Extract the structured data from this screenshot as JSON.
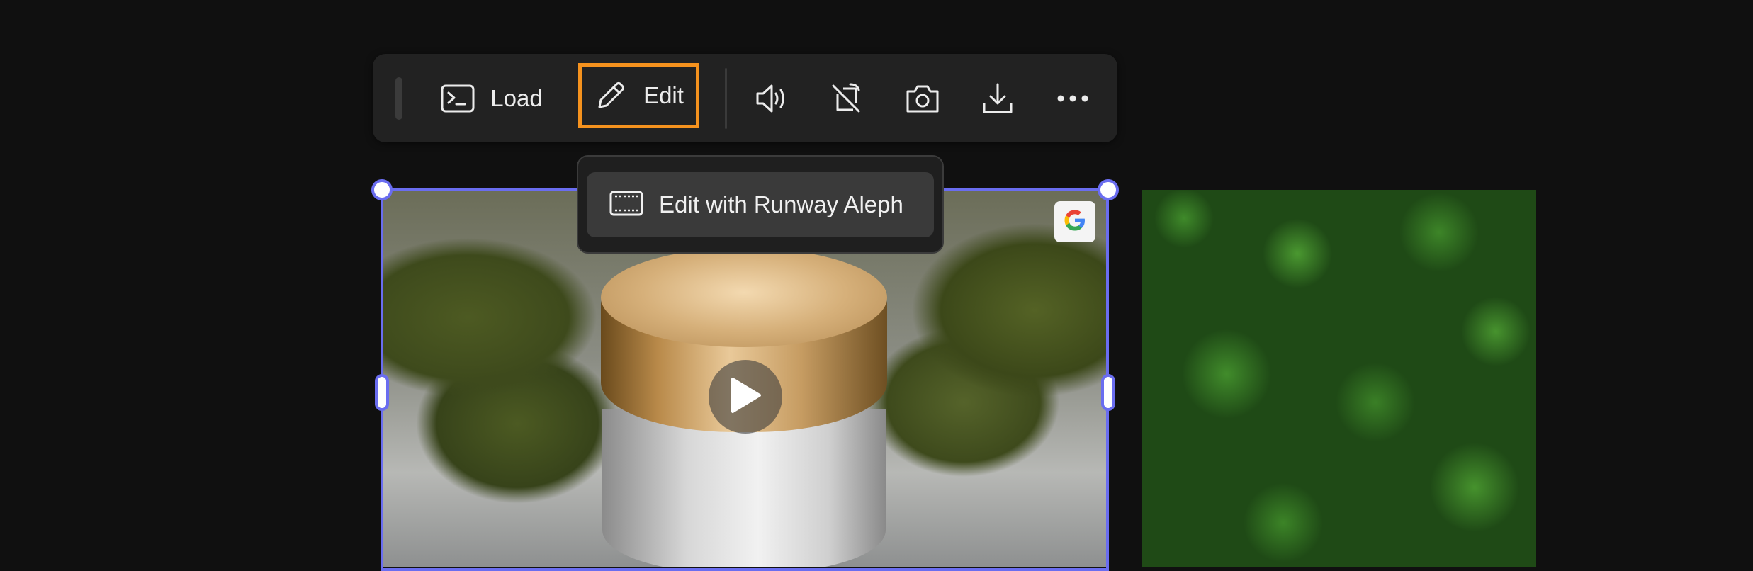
{
  "toolbar": {
    "load_label": "Load",
    "edit_label": "Edit",
    "edit_highlight_color": "#f5921e",
    "icons": [
      "terminal-icon",
      "pencil-icon",
      "speaker-icon",
      "rotate-off-icon",
      "camera-icon",
      "download-icon",
      "more-icon"
    ]
  },
  "dropdown": {
    "items": [
      {
        "label": "Edit with Runway Aleph",
        "icon": "film-frame-icon"
      }
    ]
  },
  "canvas": {
    "selection_color": "#6a6df0",
    "selected_tile": {
      "type": "video",
      "badge": "G",
      "badge_icon": "google-icon"
    },
    "second_tile": {
      "type": "image"
    }
  }
}
